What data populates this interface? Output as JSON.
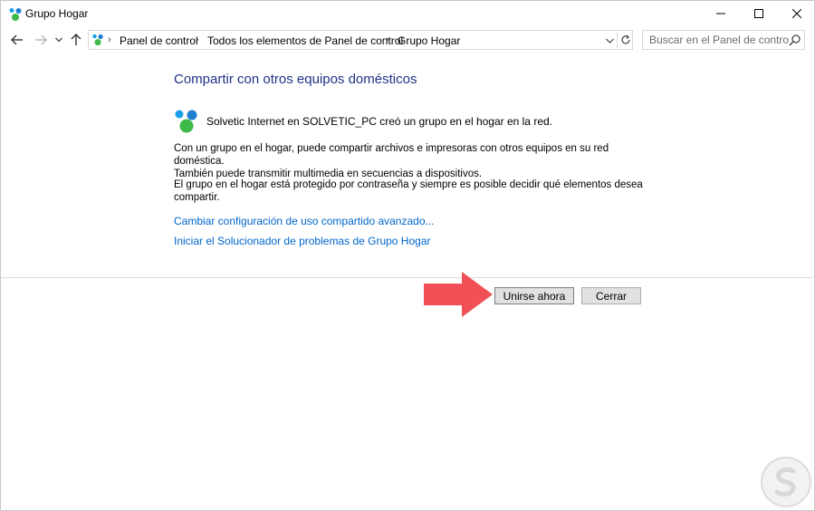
{
  "window": {
    "title": "Grupo Hogar"
  },
  "nav": {
    "breadcrumbs": [
      "Panel de control",
      "Todos los elementos de Panel de control",
      "Grupo Hogar"
    ],
    "search_placeholder": "Buscar en el Panel de control"
  },
  "content": {
    "heading": "Compartir con otros equipos domésticos",
    "info_text": "Solvetic Internet en SOLVETIC_PC creó un grupo en el hogar en la red.",
    "para1_line1": "Con un grupo en el hogar, puede compartir archivos e impresoras con otros equipos en su red doméstica.",
    "para1_line2": "También puede transmitir multimedia en secuencias a dispositivos.",
    "para2_line1": "El grupo en el hogar está protegido por contraseña y siempre es posible decidir qué elementos desea",
    "para2_line2": "compartir.",
    "link_advanced": "Cambiar configuración de uso compartido avanzado...",
    "link_troubleshooter": "Iniciar el Solucionador de problemas de Grupo Hogar"
  },
  "buttons": {
    "join": "Unirse ahora",
    "close": "Cerrar"
  },
  "icons": {
    "app": "homegroup-icon",
    "arrow": "red-arrow-icon",
    "watermark": "solvetic-logo-icon"
  },
  "colors": {
    "heading": "#1e3287",
    "link": "#0066cc",
    "arrow": "#f05056"
  }
}
